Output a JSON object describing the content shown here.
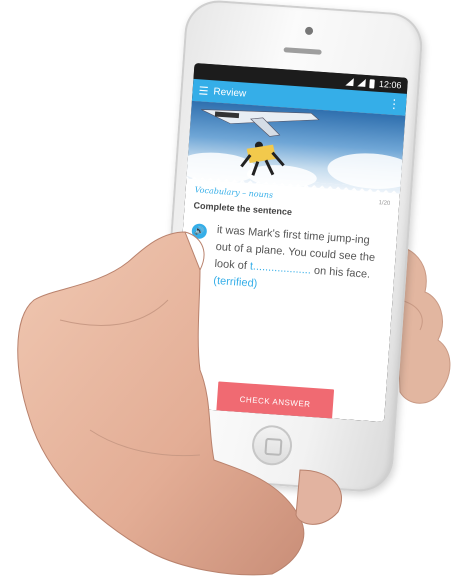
{
  "status_bar": {
    "time": "12:06"
  },
  "app_bar": {
    "menu_icon": "hamburger-icon",
    "title": "Review",
    "more_icon": "vertical-dots-icon"
  },
  "card": {
    "photo_caption": "",
    "category": "Vocabulary",
    "subcategory": "– nouns",
    "progress": "1/20",
    "instruction": "Complete the sentence",
    "sentence_part1": "it was Mark's first time jump-ing out of a plane. You could see the look of",
    "blank": "t...................",
    "sentence_part2": "on his face.",
    "hint": "(terrified)"
  },
  "actions": {
    "check_label": "CHECK ANSWER"
  },
  "colors": {
    "accent": "#35aee8",
    "button": "#f06a72"
  }
}
